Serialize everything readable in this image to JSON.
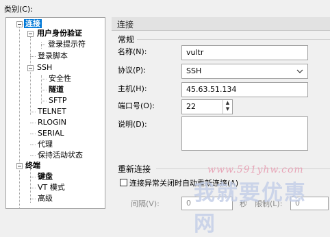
{
  "category_label": "类别(C):",
  "tree": {
    "items": [
      {
        "label": "连接",
        "bold": true,
        "selected": true
      },
      {
        "label": "用户身份验证",
        "bold": true
      },
      {
        "label": "登录提示符"
      },
      {
        "label": "登录脚本"
      },
      {
        "label": "SSH"
      },
      {
        "label": "安全性"
      },
      {
        "label": "隧道",
        "bold": true
      },
      {
        "label": "SFTP"
      },
      {
        "label": "TELNET"
      },
      {
        "label": "RLOGIN"
      },
      {
        "label": "SERIAL"
      },
      {
        "label": "代理"
      },
      {
        "label": "保持活动状态"
      },
      {
        "label": "终端",
        "bold": true
      },
      {
        "label": "键盘",
        "bold": true
      },
      {
        "label": "VT 模式"
      },
      {
        "label": "高级"
      }
    ]
  },
  "panel": {
    "header": "连接",
    "general_title": "常规",
    "name_label": "名称(N):",
    "name_value": "vultr",
    "protocol_label": "协议(P):",
    "protocol_value": "SSH",
    "host_label": "主机(H):",
    "host_value": "45.63.51.134",
    "port_label": "端口号(O):",
    "port_value": "22",
    "desc_label": "说明(D):",
    "reconnect_title": "重新连接",
    "reconnect_checkbox": "连接异常关闭时自动重新连接(A)",
    "interval_label": "间隔(V):",
    "interval_value": "0",
    "seconds_label": "秒",
    "limit_label": "限制(L):",
    "limit_value": "0"
  },
  "watermark": {
    "url": "www.591yhw.com",
    "text": "我就要优惠网"
  }
}
